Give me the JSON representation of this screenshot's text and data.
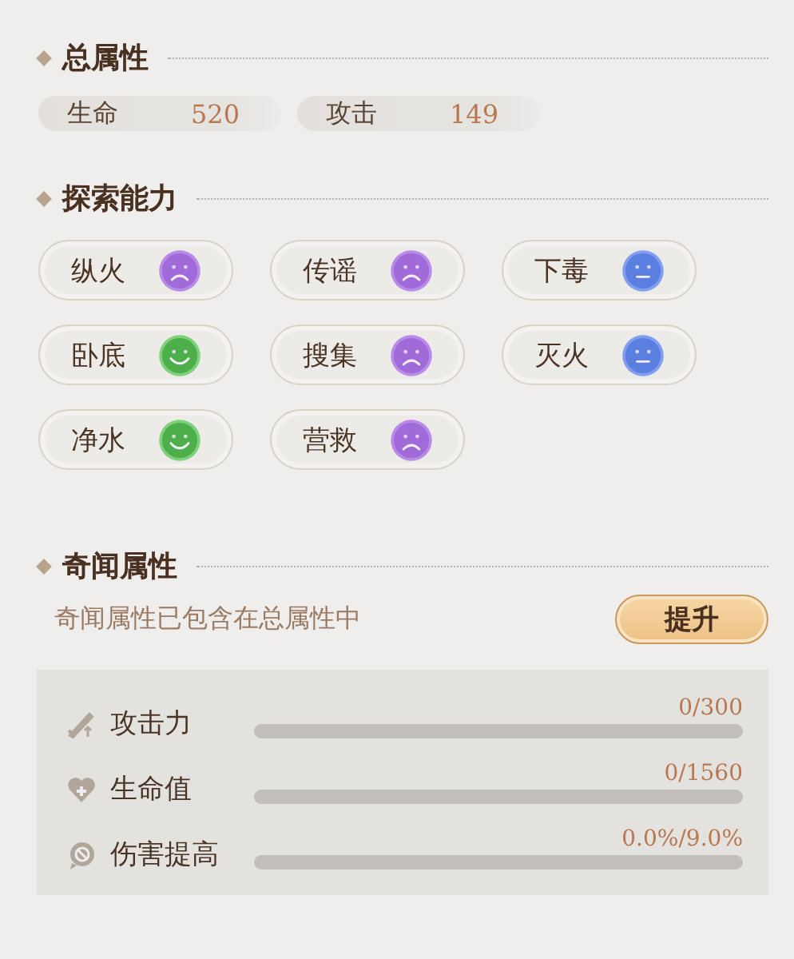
{
  "total_section": {
    "title": "总属性",
    "stats": [
      {
        "label": "生命",
        "value": "520"
      },
      {
        "label": "攻击",
        "value": "149"
      }
    ]
  },
  "explore_section": {
    "title": "探索能力",
    "abilities": [
      {
        "label": "纵火",
        "kind": "sad"
      },
      {
        "label": "传谣",
        "kind": "sad"
      },
      {
        "label": "下毒",
        "kind": "neutral"
      },
      {
        "label": "卧底",
        "kind": "happy"
      },
      {
        "label": "搜集",
        "kind": "sad"
      },
      {
        "label": "灭火",
        "kind": "neutral"
      },
      {
        "label": "净水",
        "kind": "happy"
      },
      {
        "label": "营救",
        "kind": "sad"
      }
    ]
  },
  "anecdote_section": {
    "title": "奇闻属性",
    "note": "奇闻属性已包含在总属性中",
    "button": "提升",
    "bars": [
      {
        "kind": "attack",
        "label": "攻击力",
        "reading": "0/300",
        "level": 0
      },
      {
        "kind": "health",
        "label": "生命值",
        "reading": "0/1560",
        "level": 0
      },
      {
        "kind": "damage",
        "label": "伤害提高",
        "reading": "0.0%/9.0%",
        "level": 0
      }
    ]
  }
}
